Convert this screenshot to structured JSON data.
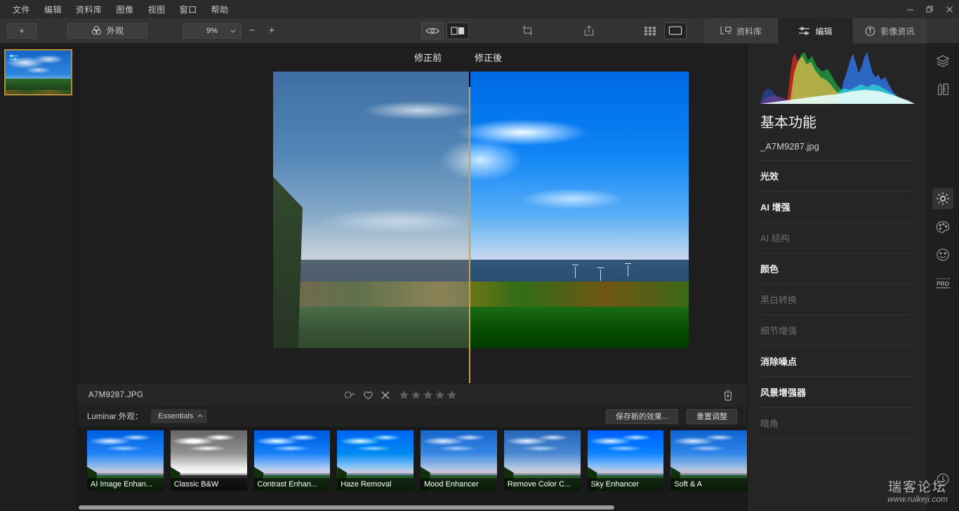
{
  "window": {
    "controls": [
      {
        "name": "minimize",
        "glyph": "minimize-icon"
      },
      {
        "name": "maximize",
        "glyph": "restore-icon"
      },
      {
        "name": "close",
        "glyph": "close-icon"
      }
    ]
  },
  "menubar": {
    "items": [
      {
        "label": "文件"
      },
      {
        "label": "编辑"
      },
      {
        "label": "资料库"
      },
      {
        "label": "图像"
      },
      {
        "label": "视图"
      },
      {
        "label": "窗口"
      },
      {
        "label": "帮助"
      }
    ]
  },
  "toolbar": {
    "add_label": "+",
    "looks_label": "外观",
    "looks_icon": "venn-circles-icon",
    "zoom_value": "9%",
    "zoom_out_label": "−",
    "zoom_in_label": "+",
    "center_icons": [
      {
        "name": "preview-eye-icon",
        "state": "framed"
      },
      {
        "name": "compare-split-icon",
        "state": "active"
      },
      {
        "name": "crop-icon",
        "state": "plain"
      },
      {
        "name": "export-share-icon",
        "state": "plain"
      },
      {
        "name": "grid-view-icon",
        "state": "plain"
      },
      {
        "name": "single-view-icon",
        "state": "active"
      }
    ]
  },
  "right_tabs": [
    {
      "label": "资料库",
      "icon": "library-icon",
      "active": false
    },
    {
      "label": "编辑",
      "icon": "sliders-icon",
      "active": true
    },
    {
      "label": "影像资讯",
      "icon": "info-icon",
      "active": false
    }
  ],
  "viewer": {
    "before_label": "修正前",
    "after_label": "修正後",
    "divider_color": "#c8a055"
  },
  "filmstrip": {
    "selected_border_color": "#b58b3c",
    "badge_icon": "adjustments-badge-icon"
  },
  "infobar": {
    "filename": "A7M9287.JPG",
    "flag_icon": "circle-arrow-icon",
    "favorite_icon": "heart-icon",
    "reject_icon": "reject-x-icon",
    "stars": 5,
    "stars_filled": 0,
    "delete_icon": "trash-icon"
  },
  "looksbar": {
    "label": "Luminar 外观：",
    "collection": "Essentials",
    "collection_chevron": "chevron-up-icon",
    "save_label": "保存新的效果...",
    "reset_label": "重置调整"
  },
  "presets": [
    {
      "label": "AI Image Enhan...",
      "style": "ai"
    },
    {
      "label": "Classic B&W",
      "style": "bw"
    },
    {
      "label": "Contrast Enhan...",
      "style": "contrast"
    },
    {
      "label": "Haze Removal",
      "style": "haze"
    },
    {
      "label": "Mood Enhancer",
      "style": "mood"
    },
    {
      "label": "Remove Color C...",
      "style": "removecolor"
    },
    {
      "label": "Sky Enhancer",
      "style": "sky"
    },
    {
      "label": "Soft & A",
      "style": "soft"
    }
  ],
  "scroll": {
    "thumb_width_pct": 80
  },
  "panel": {
    "title": "基本功能",
    "filename": "_A7M9287.jpg",
    "items": [
      {
        "label": "光效",
        "enabled": true
      },
      {
        "label": "AI 增强",
        "enabled": true
      },
      {
        "label": "AI 结构",
        "enabled": false
      },
      {
        "label": "颜色",
        "enabled": true
      },
      {
        "label": "黑白转换",
        "enabled": false
      },
      {
        "label": "细节增强",
        "enabled": false
      },
      {
        "label": "消除噪点",
        "enabled": true
      },
      {
        "label": "风景增强器",
        "enabled": true
      },
      {
        "label": "暗角",
        "enabled": false
      }
    ]
  },
  "rail": [
    {
      "name": "layers-icon",
      "active": false
    },
    {
      "name": "tools-icon",
      "active": false
    },
    {
      "name": "essentials-sun-icon",
      "active": true
    },
    {
      "name": "creative-palette-icon",
      "active": false
    },
    {
      "name": "portrait-face-icon",
      "active": false
    },
    {
      "name": "pro-icon",
      "active": false
    },
    {
      "name": "history-clock-icon",
      "active": false
    }
  ],
  "watermark": {
    "cn": "瑞客论坛",
    "url": "www.ruikeji.com"
  },
  "histogram": {
    "description": "RGB histogram of the edited photo",
    "channels": [
      "red",
      "green",
      "blue",
      "cyan",
      "yellow",
      "luminance"
    ]
  }
}
